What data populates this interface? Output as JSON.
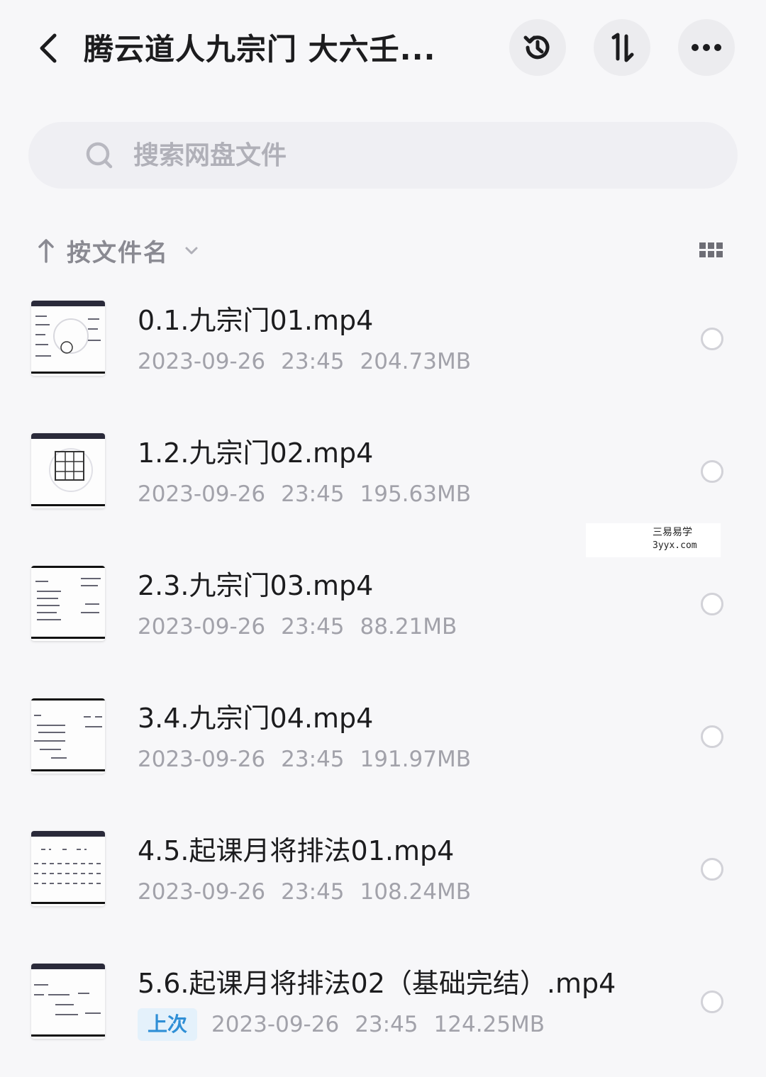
{
  "header": {
    "title": "腾云道人九宗门 大六壬...",
    "back_icon": "chevron-left-icon",
    "history_icon": "history-icon",
    "sort_icon": "sort-arrows-icon",
    "more_icon": "more-horizontal-icon"
  },
  "search": {
    "placeholder": "搜索网盘文件",
    "icon": "search-icon"
  },
  "sort": {
    "label": "按文件名",
    "direction_icon": "arrow-up-icon",
    "dropdown_icon": "chevron-down-icon",
    "view_icon": "grid-view-icon"
  },
  "files": [
    {
      "name": "0.1.九宗门01.mp4",
      "date": "2023-09-26",
      "time": "23:45",
      "size": "204.73MB",
      "badge": ""
    },
    {
      "name": "1.2.九宗门02.mp4",
      "date": "2023-09-26",
      "time": "23:45",
      "size": "195.63MB",
      "badge": ""
    },
    {
      "name": "2.3.九宗门03.mp4",
      "date": "2023-09-26",
      "time": "23:45",
      "size": "88.21MB",
      "badge": ""
    },
    {
      "name": "3.4.九宗门04.mp4",
      "date": "2023-09-26",
      "time": "23:45",
      "size": "191.97MB",
      "badge": ""
    },
    {
      "name": "4.5.起课月将排法01.mp4",
      "date": "2023-09-26",
      "time": "23:45",
      "size": "108.24MB",
      "badge": ""
    },
    {
      "name": "5.6.起课月将排法02（基础完结）.mp4",
      "date": "2023-09-26",
      "time": "23:45",
      "size": "124.25MB",
      "badge": "上次"
    }
  ],
  "watermark": {
    "line1": "三易易学",
    "line2": "3yyx.com"
  },
  "colors": {
    "background": "#f7f7f9",
    "badge_text": "#2f8fd6",
    "badge_bg": "#e4f1fb",
    "meta_text": "#a2a2aa"
  }
}
